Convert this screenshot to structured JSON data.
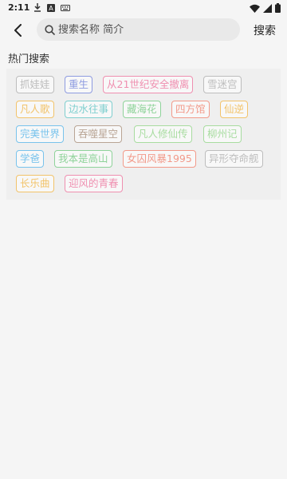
{
  "status_bar": {
    "time": "2:11"
  },
  "search": {
    "placeholder": "搜索名称 简介",
    "value": "",
    "button_label": "搜索"
  },
  "hot": {
    "title": "热门搜索",
    "tags": [
      {
        "label": "抓娃娃",
        "color": "#bdbdbd"
      },
      {
        "label": "重生",
        "color": "#8e9be0"
      },
      {
        "label": "从21世纪安全撤离",
        "color": "#ef8fb0"
      },
      {
        "label": "雪迷宫",
        "color": "#bdbdbd"
      },
      {
        "label": "凡人歌",
        "color": "#f2c36a"
      },
      {
        "label": "边水往事",
        "color": "#7fcfcf"
      },
      {
        "label": "藏海花",
        "color": "#8fd39a"
      },
      {
        "label": "四方馆",
        "color": "#f29a8a"
      },
      {
        "label": "仙逆",
        "color": "#f2c36a"
      },
      {
        "label": "完美世界",
        "color": "#79c3ec"
      },
      {
        "label": "吞噬星空",
        "color": "#b9a595"
      },
      {
        "label": "凡人修仙传",
        "color": "#a8dca0"
      },
      {
        "label": "柳州记",
        "color": "#a8dca0"
      },
      {
        "label": "学爸",
        "color": "#79c3ec"
      },
      {
        "label": "我本是高山",
        "color": "#8fd39a"
      },
      {
        "label": "女囚风暴1995",
        "color": "#f29a8a"
      },
      {
        "label": "异形夺命舰",
        "color": "#bdbdbd"
      },
      {
        "label": "长乐曲",
        "color": "#f2c36a"
      },
      {
        "label": "迎风的青春",
        "color": "#ef8fb0"
      }
    ]
  }
}
